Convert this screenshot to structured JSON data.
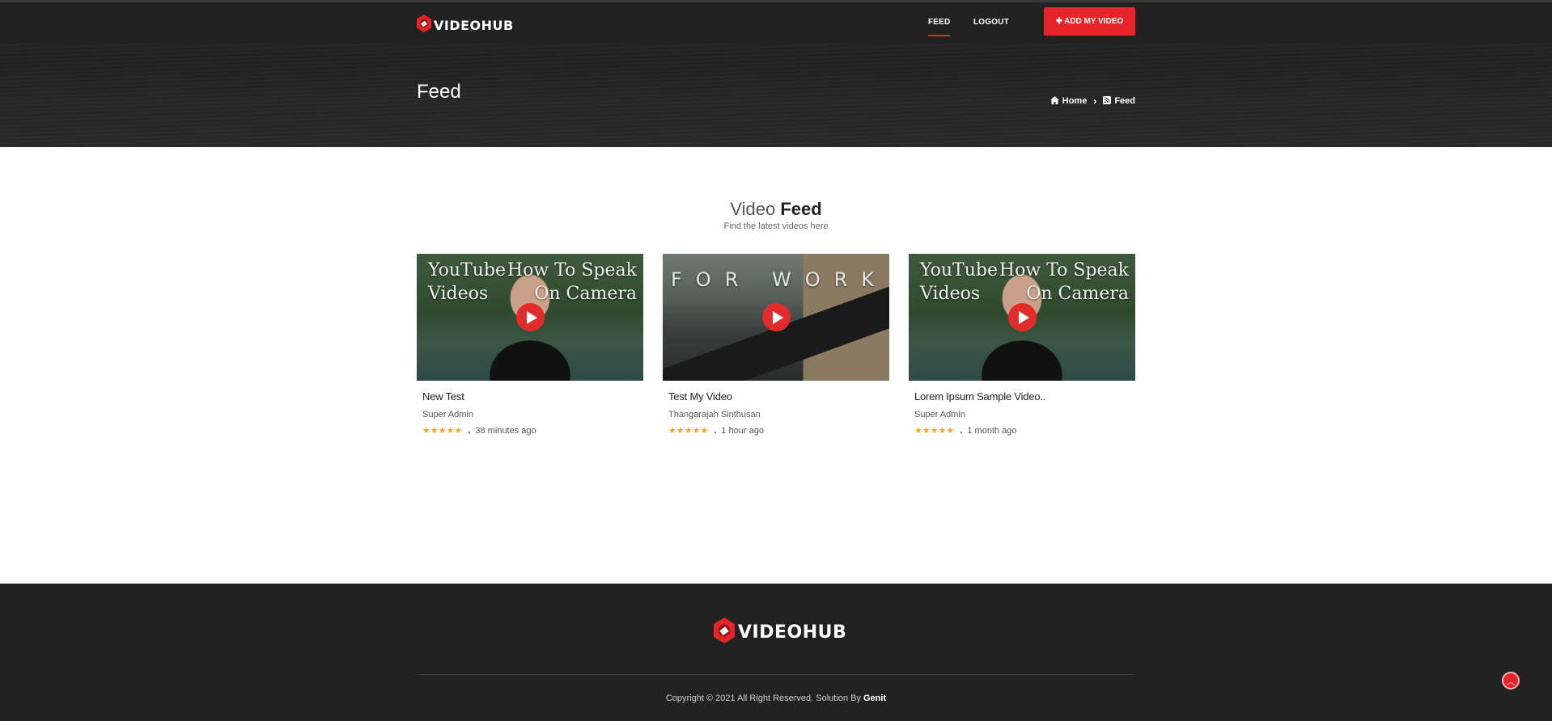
{
  "brand": {
    "name": "VIDEOHUB",
    "accent_color": "#e8232a",
    "star_color": "#f5a623"
  },
  "nav": {
    "items": [
      {
        "label": "FEED",
        "active": true
      },
      {
        "label": "LOGOUT",
        "active": false
      }
    ],
    "add_button_icon": "plus-icon",
    "add_button_label": "ADD MY VIDEO"
  },
  "header": {
    "title": "Feed",
    "breadcrumb": [
      {
        "icon": "home-icon",
        "label": "Home"
      },
      {
        "icon": "rss-icon",
        "label": "Feed"
      }
    ]
  },
  "section": {
    "title_light": "Video",
    "title_bold": "Feed",
    "subtitle": "Find the latest videos here"
  },
  "videos": [
    {
      "title": "New Test",
      "author": "Super Admin",
      "rating": 5,
      "stars": "★★★★★",
      "time": "38 minutes ago",
      "thumb_left_text": "YouTube\nVideos",
      "thumb_right_text": "How To Speak\nOn Camera"
    },
    {
      "title": "Test My Video",
      "author": "Thangarajah Sinthusan",
      "rating": 5,
      "stars": "★★★★★",
      "time": "1 hour ago",
      "thumb_text": "FOR WORK"
    },
    {
      "title": "Lorem Ipsum Sample Video..",
      "author": "Super Admin",
      "rating": 5,
      "stars": "★★★★★",
      "time": "1 month ago",
      "thumb_left_text": "YouTube\nVideos",
      "thumb_right_text": "How To Speak\nOn Camera"
    }
  ],
  "footer": {
    "copyright": "Copyright © 2021 All Right Reserved. Solution By",
    "brand_link": "Genit",
    "scroll_top_icon": "chevron-up-icon"
  }
}
